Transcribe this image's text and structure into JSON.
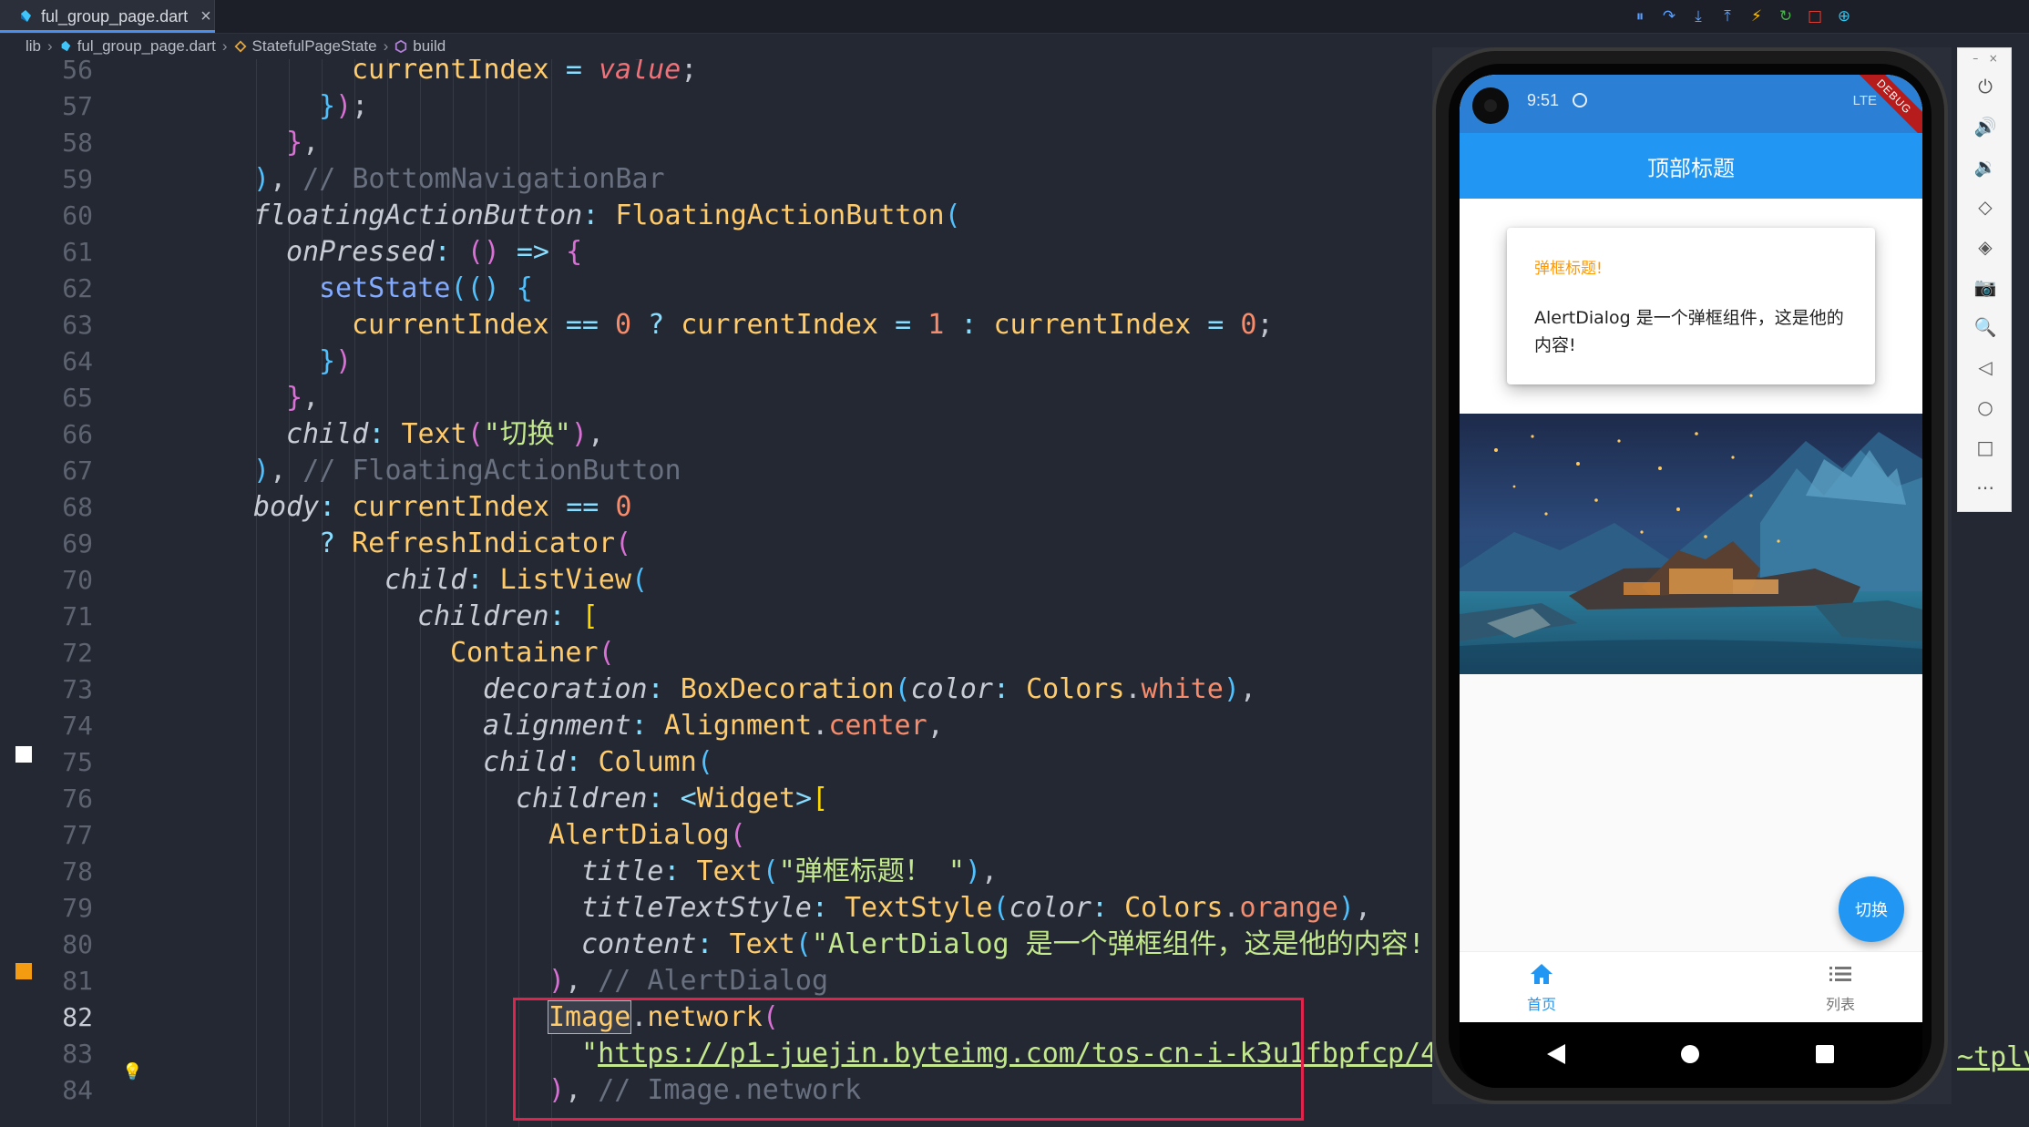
{
  "tab": {
    "filename": "ful_group_page.dart",
    "close": "×"
  },
  "colors": {
    "accent": "#4a8ff0",
    "appbar": "#2196f3",
    "dialog_title": "#ff9800",
    "highlight_box": "#e0234a"
  },
  "breadcrumb": [
    "lib",
    "ful_group_page.dart",
    "StatefulPageState",
    "build"
  ],
  "debug_toolbar": [
    "pause-icon",
    "step-over-icon",
    "step-into-icon",
    "step-out-icon",
    "hot-reload-icon",
    "hot-restart-icon",
    "stop-icon",
    "inspect-icon"
  ],
  "code": {
    "ln": [
      "56",
      "57",
      "58",
      "59",
      "60",
      "61",
      "62",
      "63",
      "64",
      "65",
      "66",
      "67",
      "68",
      "69",
      "70",
      "71",
      "72",
      "73",
      "74",
      "75",
      "76",
      "77",
      "78",
      "79",
      "80",
      "81",
      "82",
      "83",
      "84"
    ],
    "s": {
      "currentIndex": "currentIndex",
      "value": "value",
      "comment_bnb": "// BottomNavigationBar",
      "floatingActionButton": "floatingActionButton",
      "FloatingActionButton": "FloatingActionButton",
      "onPressed": "onPressed",
      "setState": "setState",
      "n0": "0",
      "n1": "1",
      "child": "child",
      "Text": "Text",
      "str_switch": "\"切换\"",
      "comment_fab": "// FloatingActionButton",
      "body": "body",
      "RefreshIndicator": "RefreshIndicator",
      "ListView": "ListView",
      "children": "children",
      "Container": "Container",
      "decoration": "decoration",
      "BoxDecoration": "BoxDecoration",
      "color": "color",
      "Colors": "Colors",
      "white": "white",
      "alignment": "alignment",
      "Alignment": "Alignment",
      "center": "center",
      "Column": "Column",
      "Widget": "Widget",
      "AlertDialog": "AlertDialog",
      "title": "title",
      "str_title": "\"弹框标题！ \"",
      "titleTextStyle": "titleTextStyle",
      "TextStyle": "TextStyle",
      "orange": "orange",
      "content": "content",
      "str_content": "\"AlertDialog 是一个弹框组件，这是他的内容!",
      "comment_ad": "// AlertDialog",
      "Image": "Image",
      "network": "network",
      "url": "https://p1-juejin.byteimg.com/tos-cn-i-k3u1fbpfcp/4",
      "url_tail": "~tplv-",
      "comment_img": "// Image.network"
    }
  },
  "emulator": {
    "time": "9:51",
    "network": "LTE",
    "debug_banner": "DEBUG",
    "appbar_title": "顶部标题",
    "dialog_title": "弹框标题!",
    "dialog_content": "AlertDialog 是一个弹框组件，这是他的内容!",
    "fab_label": "切换",
    "nav": [
      {
        "label": "首页",
        "icon": "home-icon",
        "active": true
      },
      {
        "label": "列表",
        "icon": "list-icon",
        "active": false
      }
    ]
  },
  "side_toolbar": [
    "power-icon",
    "volume-up-icon",
    "volume-down-icon",
    "rotate-left-icon",
    "rotate-right-icon",
    "camera-icon",
    "zoom-icon",
    "back-icon",
    "home-icon",
    "overview-icon",
    "more-icon"
  ]
}
